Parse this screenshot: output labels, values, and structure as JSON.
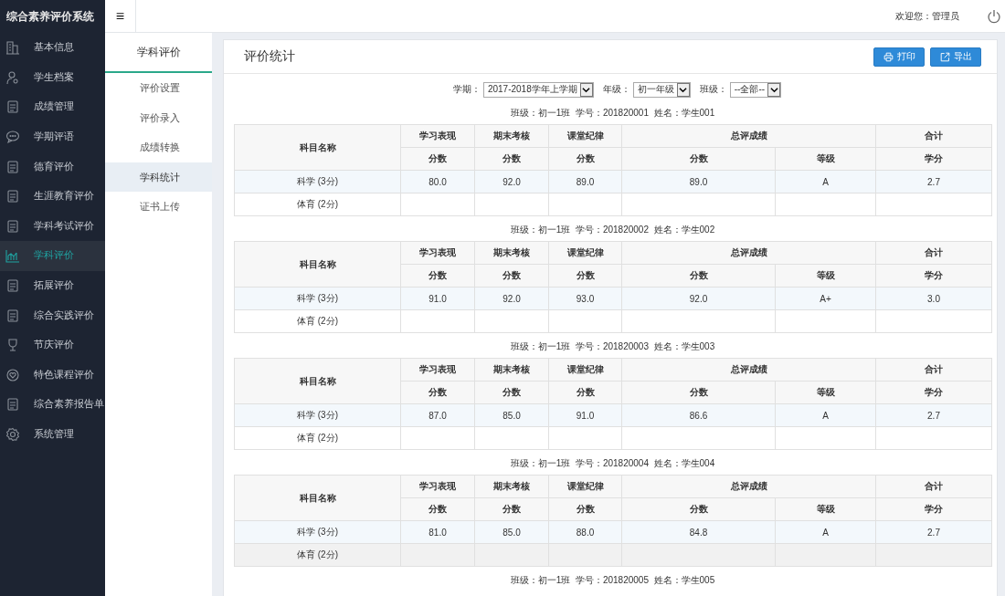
{
  "app_title": "综合素养评价系统",
  "sidebar": {
    "items": [
      {
        "label": "基本信息",
        "selected": false
      },
      {
        "label": "学生档案",
        "selected": false
      },
      {
        "label": "成绩管理",
        "selected": false
      },
      {
        "label": "学期评语",
        "selected": false
      },
      {
        "label": "德育评价",
        "selected": false
      },
      {
        "label": "生涯教育评价",
        "selected": false
      },
      {
        "label": "学科考试评价",
        "selected": false
      },
      {
        "label": "学科评价",
        "selected": true
      },
      {
        "label": "拓展评价",
        "selected": false
      },
      {
        "label": "综合实践评价",
        "selected": false
      },
      {
        "label": "节庆评价",
        "selected": false
      },
      {
        "label": "特色课程评价",
        "selected": false
      },
      {
        "label": "综合素养报告单",
        "selected": false
      },
      {
        "label": "系统管理",
        "selected": false
      }
    ]
  },
  "topbar": {
    "menu_glyph": "≡",
    "welcome": "欢迎您：管理员"
  },
  "subnav": {
    "title": "学科评价",
    "items": [
      {
        "label": "评价设置",
        "selected": false
      },
      {
        "label": "评价录入",
        "selected": false
      },
      {
        "label": "成绩转换",
        "selected": false
      },
      {
        "label": "学科统计",
        "selected": true
      },
      {
        "label": "证书上传",
        "selected": false
      }
    ]
  },
  "panel": {
    "title": "评价统计",
    "buttons": [
      "打印",
      "导出"
    ],
    "filters": [
      {
        "label": "学期：",
        "value": "2017-2018学年上学期"
      },
      {
        "label": "年级：",
        "value": "初一年级"
      },
      {
        "label": "班级：",
        "value": "--全部--"
      }
    ],
    "students": [
      {
        "caption": "班级：初一1班  学号：201820001  姓名：学生001",
        "header": {
          "first": "科目名称",
          "groups": [
            "学习表现",
            "期末考核",
            "课堂纪律",
            "总评成绩",
            "合计"
          ],
          "sub": [
            "分数",
            "分数",
            "分数",
            "分数",
            "等级",
            "学分"
          ]
        },
        "rows": [
          {
            "subject": "科学 (3分)",
            "highlighted": true,
            "hovered": false,
            "cells": [
              "80.0",
              "92.0",
              "89.0",
              "89.0",
              "A",
              "2.7"
            ]
          },
          {
            "subject": "体育 (2分)",
            "highlighted": false,
            "hovered": false
          }
        ]
      },
      {
        "caption": "班级：初一1班  学号：201820002  姓名：学生002",
        "header": {
          "first": "科目名称",
          "groups": [
            "学习表现",
            "期末考核",
            "课堂纪律",
            "总评成绩",
            "合计"
          ],
          "sub": [
            "分数",
            "分数",
            "分数",
            "分数",
            "等级",
            "学分"
          ]
        },
        "rows": [
          {
            "subject": "科学 (3分)",
            "highlighted": true,
            "hovered": false,
            "cells": [
              "91.0",
              "92.0",
              "93.0",
              "92.0",
              "A+",
              "3.0"
            ]
          },
          {
            "subject": "体育 (2分)",
            "highlighted": false,
            "hovered": false
          }
        ]
      },
      {
        "caption": "班级：初一1班  学号：201820003  姓名：学生003",
        "header": {
          "first": "科目名称",
          "groups": [
            "学习表现",
            "期末考核",
            "课堂纪律",
            "总评成绩",
            "合计"
          ],
          "sub": [
            "分数",
            "分数",
            "分数",
            "分数",
            "等级",
            "学分"
          ]
        },
        "rows": [
          {
            "subject": "科学 (3分)",
            "highlighted": true,
            "hovered": false,
            "cells": [
              "87.0",
              "85.0",
              "91.0",
              "86.6",
              "A",
              "2.7"
            ]
          },
          {
            "subject": "体育 (2分)",
            "highlighted": false,
            "hovered": false
          }
        ]
      },
      {
        "caption": "班级：初一1班  学号：201820004  姓名：学生004",
        "header": {
          "first": "科目名称",
          "groups": [
            "学习表现",
            "期末考核",
            "课堂纪律",
            "总评成绩",
            "合计"
          ],
          "sub": [
            "分数",
            "分数",
            "分数",
            "分数",
            "等级",
            "学分"
          ]
        },
        "rows": [
          {
            "subject": "科学 (3分)",
            "highlighted": true,
            "hovered": false,
            "cells": [
              "81.0",
              "85.0",
              "88.0",
              "84.8",
              "A",
              "2.7"
            ]
          },
          {
            "subject": "体育 (2分)",
            "highlighted": false,
            "hovered": true
          }
        ]
      },
      {
        "caption": "班级：初一1班  学号：201820005  姓名：学生005"
      }
    ]
  }
}
